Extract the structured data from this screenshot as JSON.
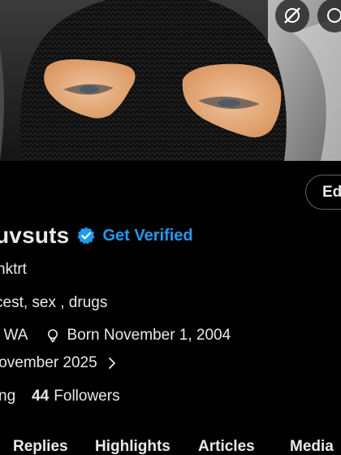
{
  "profile": {
    "display_name": "uvsuts",
    "verified_cta": "Get Verified",
    "handle": "hktrt",
    "bio": "cest, sex , drugs",
    "location": ", WA",
    "birthday": "Born November 1, 2004",
    "joined": "lovember 2025",
    "following_label": "ng",
    "followers_count": "44",
    "followers_label": "Followers"
  },
  "actions": {
    "edit_label": "Ed"
  },
  "tabs": [
    {
      "label": "Replies"
    },
    {
      "label": "Highlights"
    },
    {
      "label": "Articles"
    },
    {
      "label": "Media"
    }
  ],
  "colors": {
    "background": "#000000",
    "text": "#e7e9ea",
    "accent": "#1d9bf0",
    "border": "#536471"
  },
  "icons": {
    "banner_left": "no-media-icon",
    "banner_right": "more-icon",
    "verified": "verified-badge-icon",
    "location": "location-pin-icon",
    "joined_chevron": "chevron-right-icon"
  }
}
